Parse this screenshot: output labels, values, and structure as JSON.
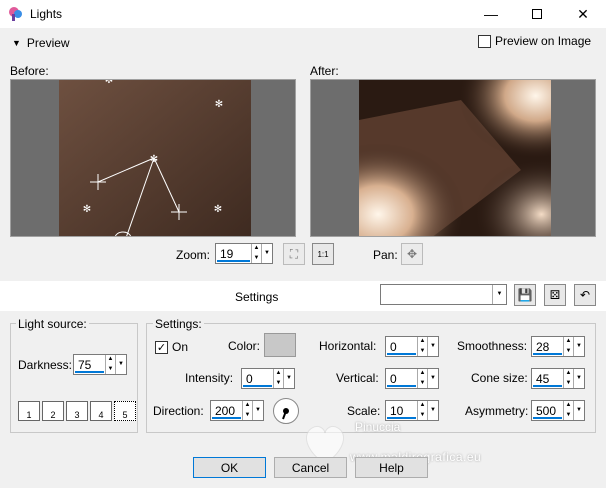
{
  "window": {
    "title": "Lights"
  },
  "preview": {
    "toggle_label": "Preview",
    "preview_on_image_label": "Preview on Image",
    "before_label": "Before:",
    "after_label": "After:"
  },
  "zoom": {
    "label": "Zoom:",
    "value": "19",
    "pan_label": "Pan:"
  },
  "settings_bar": {
    "label": "Settings"
  },
  "light_source": {
    "title": "Light source:",
    "darkness_label": "Darkness:",
    "darkness_value": "75",
    "presets": [
      "1",
      "2",
      "3",
      "4",
      "5"
    ]
  },
  "settings": {
    "title": "Settings:",
    "on_label": "On",
    "color_label": "Color:",
    "color_value": "#c8c8c8",
    "intensity_label": "Intensity:",
    "intensity_value": "0",
    "direction_label": "Direction:",
    "direction_value": "200",
    "horizontal_label": "Horizontal:",
    "horizontal_value": "0",
    "vertical_label": "Vertical:",
    "vertical_value": "0",
    "scale_label": "Scale:",
    "scale_value": "10",
    "smoothness_label": "Smoothness:",
    "smoothness_value": "28",
    "cone_size_label": "Cone size:",
    "cone_size_value": "45",
    "asymmetry_label": "Asymmetry:",
    "asymmetry_value": "500"
  },
  "buttons": {
    "ok": "OK",
    "cancel": "Cancel",
    "help": "Help"
  },
  "watermark": {
    "line1": "Pinuccia",
    "line2": "www.maldiregrafica.eu"
  }
}
